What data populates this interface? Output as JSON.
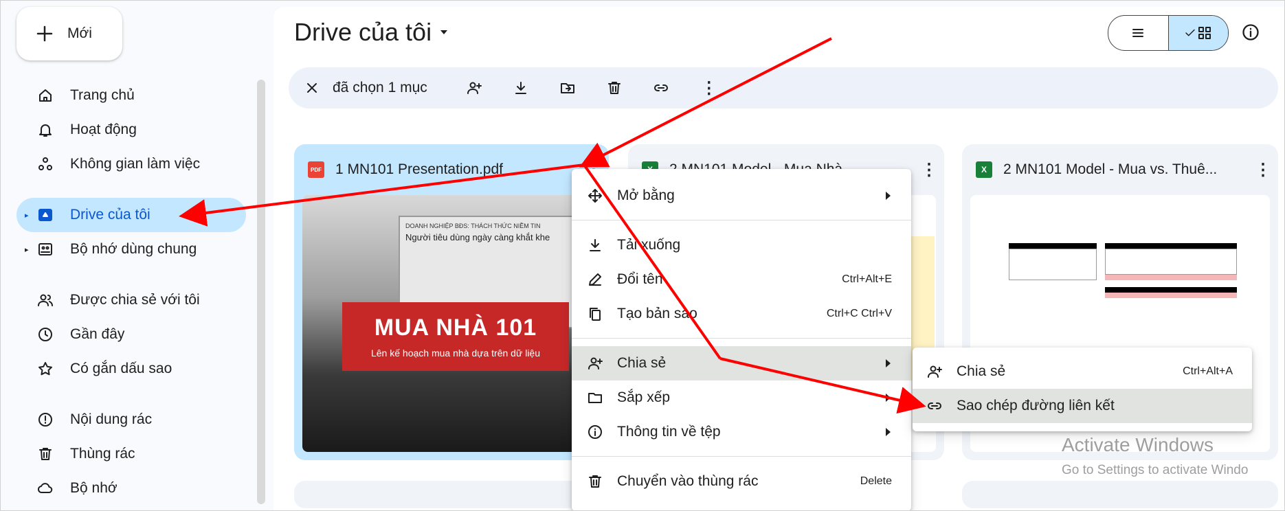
{
  "new_button": {
    "label": "Mới"
  },
  "sidebar": {
    "items": [
      {
        "label": "Trang chủ",
        "icon": "home-icon"
      },
      {
        "label": "Hoạt động",
        "icon": "bell-icon"
      },
      {
        "label": "Không gian làm việc",
        "icon": "workspaces-icon"
      },
      {
        "label": "Drive của tôi",
        "icon": "drive-icon",
        "active": true
      },
      {
        "label": "Bộ nhớ dùng chung",
        "icon": "shared-drives-icon"
      },
      {
        "label": "Được chia sẻ với tôi",
        "icon": "people-icon"
      },
      {
        "label": "Gần đây",
        "icon": "clock-icon"
      },
      {
        "label": "Có gắn dấu sao",
        "icon": "star-icon"
      },
      {
        "label": "Nội dung rác",
        "icon": "spam-icon"
      },
      {
        "label": "Thùng rác",
        "icon": "trash-icon"
      },
      {
        "label": "Bộ nhớ",
        "icon": "cloud-icon"
      }
    ]
  },
  "header": {
    "title": "Drive của tôi"
  },
  "selection_bar": {
    "count_text": "đã chọn 1 mục"
  },
  "files": [
    {
      "name": "1 MN101 Presentation.pdf",
      "type": "pdf",
      "badge": "PDF"
    },
    {
      "name": "2 MN101 Model - Mua Nhà",
      "type": "xlsx",
      "badge": "X"
    },
    {
      "name": "2 MN101 Model - Mua vs. Thuê...",
      "type": "xlsx",
      "badge": "X"
    }
  ],
  "thumbnail": {
    "headline": "MUA NHÀ 101",
    "subline": "Lên kế hoạch mua nhà dựa trên dữ liệu",
    "screen_small": "DOANH NGHIỆP BĐS: THÁCH THỨC NIỀM TIN",
    "screen_large": "Người tiêu dùng ngày càng khắt khe"
  },
  "context_menu": {
    "items": [
      {
        "label": "Mở bằng",
        "icon": "open-with-icon",
        "submenu": true
      },
      {
        "label": "Tải xuống",
        "icon": "download-icon"
      },
      {
        "label": "Đổi tên",
        "icon": "rename-icon",
        "shortcut": "Ctrl+Alt+E"
      },
      {
        "label": "Tạo bản sao",
        "icon": "copy-icon",
        "shortcut": "Ctrl+C Ctrl+V"
      },
      {
        "label": "Chia sẻ",
        "icon": "share-icon",
        "submenu": true
      },
      {
        "label": "Sắp xếp",
        "icon": "folder-icon",
        "submenu": true
      },
      {
        "label": "Thông tin về tệp",
        "icon": "info-icon",
        "submenu": true
      },
      {
        "label": "Chuyển vào thùng rác",
        "icon": "trash-icon",
        "shortcut": "Delete"
      }
    ]
  },
  "share_submenu": {
    "items": [
      {
        "label": "Chia sẻ",
        "icon": "share-icon",
        "shortcut": "Ctrl+Alt+A"
      },
      {
        "label": "Sao chép đường liên kết",
        "icon": "link-icon"
      }
    ]
  },
  "watermark": {
    "line1": "Activate Windows",
    "line2": "Go to Settings to activate Windo"
  },
  "colors": {
    "active_bg": "#c2e7ff",
    "active_text": "#0b57d0",
    "annotation_arrow": "#ff0000"
  }
}
